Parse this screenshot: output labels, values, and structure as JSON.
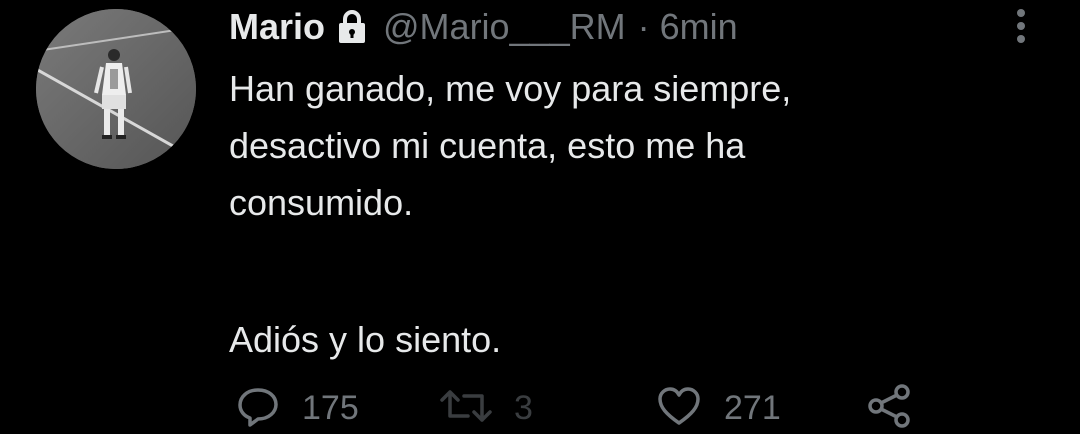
{
  "tweet": {
    "display_name": "Mario",
    "handle": "@Mario___RM",
    "separator": "·",
    "timestamp": "6min",
    "locked": true,
    "lock_icon": "lock-icon",
    "text_lines": [
      "Han ganado, me voy para siempre,",
      "desactivo mi cuenta, esto me ha",
      "consumido."
    ],
    "text_final": "Adiós y lo siento.",
    "reply_count": "175",
    "retweet_count": "3",
    "like_count": "271"
  },
  "icons": {
    "reply": "speech-bubble-icon",
    "retweet": "retweet-icon",
    "like": "heart-icon",
    "share": "share-icon",
    "more": "more-vertical-icon"
  },
  "colors": {
    "background": "#000000",
    "primary_text": "#e7e9ea",
    "secondary_text": "#71767b",
    "disabled_icon": "#3a3d40"
  }
}
